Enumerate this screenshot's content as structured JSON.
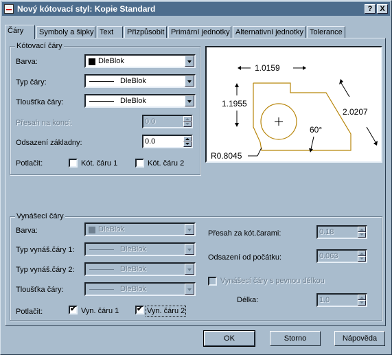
{
  "window": {
    "title": "Nový kótovací styl: Kopie Standard",
    "help_btn": "?",
    "close_btn": "X"
  },
  "tabs": [
    {
      "label": "Čáry"
    },
    {
      "label": "Symboly a šipky"
    },
    {
      "label": "Text"
    },
    {
      "label": "Přizpůsobit"
    },
    {
      "label": "Primární jednotky"
    },
    {
      "label": "Alternativní jednotky"
    },
    {
      "label": "Tolerance"
    }
  ],
  "dim_lines": {
    "title": "Kótovací čáry",
    "color_label": "Barva:",
    "color_value": "DleBlok",
    "linetype_label": "Typ čáry:",
    "linetype_value": "DleBlok",
    "lineweight_label": "Tloušťka čáry:",
    "lineweight_value": "DleBlok",
    "extend_label": "Přesah na konci:",
    "extend_value": "0.0",
    "baseline_label": "Odsazení základny:",
    "baseline_value": "0.0",
    "suppress_label": "Potlačit:",
    "suppress1_label": "Kót. čáru 1",
    "suppress2_label": "Kót. čáru 2"
  },
  "ext_lines": {
    "title": "Vynášecí čáry",
    "color_label": "Barva:",
    "color_value": "DleBlok",
    "linetype1_label": "Typ vynáš.čáry 1:",
    "linetype1_value": "DleBlok",
    "linetype2_label": "Typ vynáš.čáry 2:",
    "linetype2_value": "DleBlok",
    "lineweight_label": "Tloušťka čáry:",
    "lineweight_value": "DleBlok",
    "suppress_label": "Potlačit:",
    "suppress1_label": "Vyn. čáru 1",
    "suppress2_label": "Vyn. čáru 2",
    "beyond_label": "Přesah za kót.čarami:",
    "beyond_value": "0.18",
    "offset_label": "Odsazení od počátku:",
    "offset_value": "0.063",
    "fixed_label": "Vynášecí čáry s pevnou délkou",
    "length_label": "Délka:",
    "length_value": "1.0"
  },
  "preview": {
    "dim_top": "1.0159",
    "dim_left": "1.1955",
    "dim_right": "2.0207",
    "angle": "60°",
    "radius": "R0.8045",
    "center_mark": "+"
  },
  "buttons": {
    "ok": "OK",
    "cancel": "Storno",
    "help": "Nápověda"
  },
  "colors": {
    "dialog_bg": "#a9bccd",
    "titlebar": "#4d6d8d",
    "preview_outline": "#b8860b"
  }
}
